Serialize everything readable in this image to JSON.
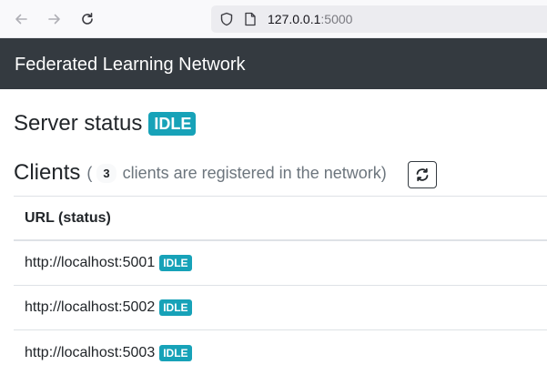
{
  "browser": {
    "url_host": "127.0.0.1",
    "url_port": ":5000",
    "icons": [
      "back-arrow-icon",
      "forward-arrow-icon",
      "reload-icon",
      "shield-icon",
      "page-icon"
    ]
  },
  "navbar": {
    "brand": "Federated Learning Network",
    "background": "#343a40"
  },
  "server": {
    "heading": "Server status",
    "status": "IDLE",
    "status_color": "#17a2b8"
  },
  "clients": {
    "heading": "Clients",
    "open_paren": "(",
    "count": "3",
    "subtitle": "clients are registered in the network)",
    "refresh_icon": "refresh-icon"
  },
  "table": {
    "header": "URL (status)",
    "rows": [
      {
        "url": "http://localhost:5001",
        "status": "IDLE"
      },
      {
        "url": "http://localhost:5002",
        "status": "IDLE"
      },
      {
        "url": "http://localhost:5003",
        "status": "IDLE"
      }
    ]
  }
}
